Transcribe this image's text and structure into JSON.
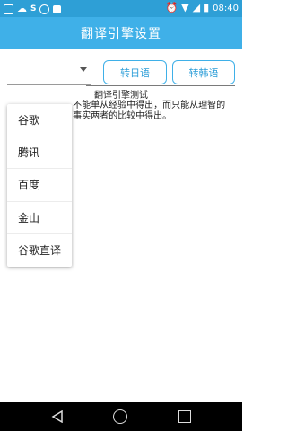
{
  "status_bar": {
    "left_icons": [
      "image-icon",
      "cloud-icon",
      "s-app-icon",
      "circle-icon",
      "square-icon"
    ],
    "right_icons": [
      "alarm-icon",
      "wifi-icon",
      "signal-icon",
      "battery-icon"
    ],
    "time": "08:40"
  },
  "app_bar": {
    "title": "翻译引擎设置"
  },
  "buttons": {
    "to_japanese": "转日语",
    "to_korean": "转韩语"
  },
  "test": {
    "title": "翻译引擎测试",
    "line1": "                       不能单从经验中得出，而只能从理智的",
    "line2": "                       事实两者的比较中得出。"
  },
  "menu": {
    "items": [
      "谷歌",
      "腾讯",
      "百度",
      "金山",
      "谷歌直译"
    ]
  },
  "colors": {
    "status_bar": "#2e9fd6",
    "app_bar": "#3fb0e8",
    "accent": "#2d9ed8"
  },
  "nav_bar": {
    "icons": [
      "back-icon",
      "home-icon",
      "recent-apps-icon"
    ]
  }
}
